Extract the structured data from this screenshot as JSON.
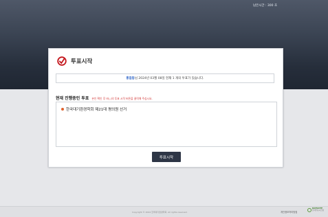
{
  "header": {
    "timer_text": "남은시간 : 300 초"
  },
  "brand": {
    "title": "투표시작",
    "logo_icon": "vote-check-icon"
  },
  "notice": {
    "name": "홍길동",
    "text": "님 2024년 03월 08일 현재 1 개의 투표가 있습니다."
  },
  "section": {
    "title": "현재 진행중인 투표",
    "hint": "본인 확인 후 바(,)의 투표 시작 버튼을 클릭해 주십시요."
  },
  "votes": [
    {
      "label": "한국대기환경학회 제21대 평의원 선거"
    }
  ],
  "actions": {
    "start_label": "투표시작"
  },
  "footer": {
    "copyright": "Copyright © 2024 한국대기환경학회. All rights reserved.",
    "privacy_label": "개인정보처리방침",
    "logo_line1": "DATAVOTE",
    "logo_line2": "전자투표시스템"
  },
  "colors": {
    "header_dark": "#262e3b",
    "button_bg": "#2e3646",
    "accent_red": "#d23a3a",
    "name_blue": "#2b63c8"
  }
}
